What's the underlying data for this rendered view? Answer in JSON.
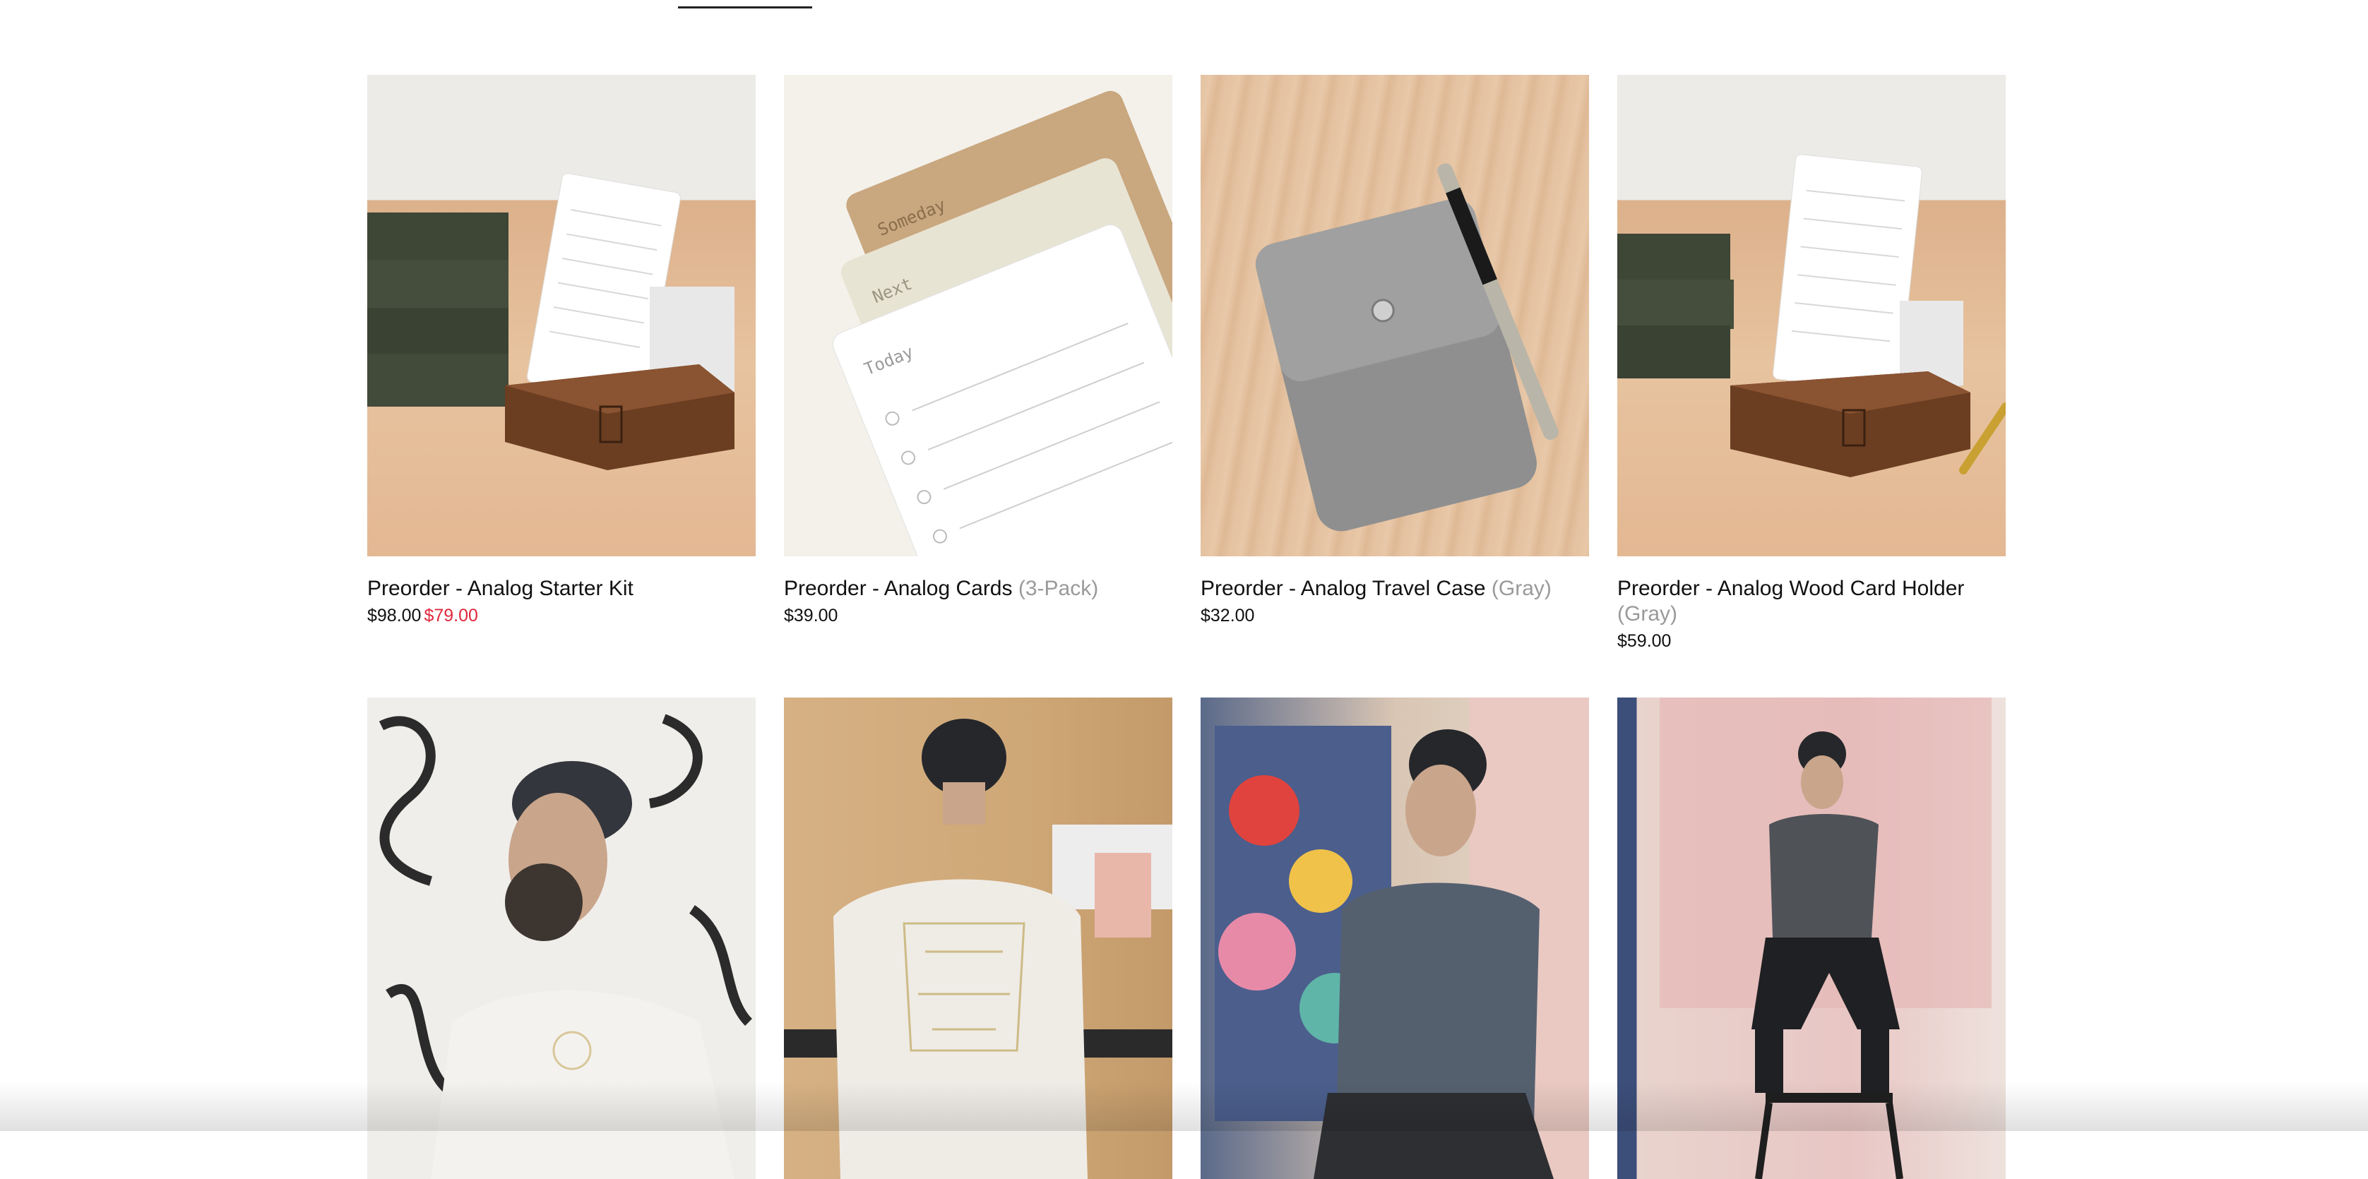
{
  "products": [
    {
      "title": "Preorder - Analog Starter Kit",
      "variant": "",
      "price": "$98.00",
      "sale_price": "$79.00",
      "image": "analog-starter-kit-photo"
    },
    {
      "title": "Preorder - Analog Cards",
      "variant": "(3-Pack)",
      "price": "$39.00",
      "sale_price": "",
      "image": "analog-cards-photo"
    },
    {
      "title": "Preorder - Analog Travel Case",
      "variant": "(Gray)",
      "price": "$32.00",
      "sale_price": "",
      "image": "analog-travel-case-photo"
    },
    {
      "title": "Preorder - Analog Wood Card Holder",
      "variant": "(Gray)",
      "price": "$59.00",
      "sale_price": "",
      "image": "analog-wood-card-holder-photo"
    }
  ],
  "row2_images": [
    "white-tee-model-photo",
    "white-tee-back-photo",
    "gray-tee-seated-photo",
    "gray-tee-stool-photo"
  ],
  "colors": {
    "text": "#111111",
    "variant": "#9a9a9a",
    "sale": "#e0283c",
    "background": "#ffffff"
  },
  "card_labels": {
    "today": "Today",
    "next": "Next",
    "someday": "Someday"
  }
}
